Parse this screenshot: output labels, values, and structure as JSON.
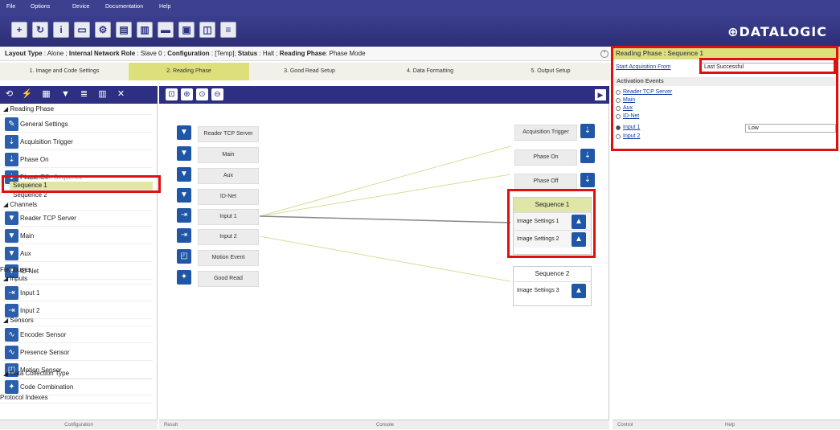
{
  "menu": [
    "File",
    "Options",
    "Device",
    "Documentation",
    "Help"
  ],
  "brand": "DATALOGIC",
  "info": {
    "layout_type_label": "Layout Type",
    "layout_type": "Alone",
    "network_role_label": "Internal Network Role",
    "network_role": "Slave 0",
    "configuration_label": "Configuration",
    "configuration": "[Temp]",
    "status_label": "Status",
    "status": "Halt",
    "reading_phase_label": "Reading Phase",
    "reading_phase": "Phase Mode"
  },
  "steps": [
    "1. Image and Code Settings",
    "2. Reading Phase",
    "3. Good Read Setup",
    "4. Data Formatting",
    "5. Output Setup"
  ],
  "tree": {
    "reading_phase": "Reading Phase",
    "general_settings": "General Settings",
    "acquisition_trigger": "Acquisition Trigger",
    "phase_on": "Phase On",
    "phase_off": "Phase Off",
    "acquisition_sequence": "Acquisition Sequence",
    "sequence1": "Sequence 1",
    "sequence2": "Sequence 2",
    "channels": "Channels",
    "reader_tcp_server": "Reader TCP Server",
    "main": "Main",
    "aux": "Aux",
    "id_net": "ID-Net",
    "fieldbuses": "Fieldbuses",
    "inputs": "Inputs",
    "input1": "Input 1",
    "input2": "Input 2",
    "sensors": "Sensors",
    "encoder_sensor": "Encoder Sensor",
    "presence_sensor": "Presence Sensor",
    "motion_sensor": "Motion Sensor",
    "data_collection_type": "Data Collection Type",
    "code_combination": "Code Combination",
    "protocol_indexes": "Protocol Indexes"
  },
  "left_footer": "Configuration",
  "canvas": {
    "left_nodes": [
      "Reader TCP Server",
      "Main",
      "Aux",
      "ID-Net",
      "Input 1",
      "Input 2",
      "Motion Event",
      "Good Read"
    ],
    "right_nodes": [
      "Acquisition Trigger",
      "Phase On",
      "Phase Off"
    ],
    "seq1": {
      "title": "Sequence  1",
      "rows": [
        "Image Settings  1",
        "Image Settings  2"
      ]
    },
    "seq2": {
      "title": "Sequence  2",
      "rows": [
        "Image Settings  3"
      ]
    }
  },
  "console": {
    "result": "Result",
    "console": "Console"
  },
  "right": {
    "title": "Reading Phase  :  Sequence 1",
    "acq_label": "Start Acquisition From",
    "acq_value": "Last Successful",
    "activation_header": "Activation Events",
    "events": [
      "Reader TCP Server",
      "Main",
      "Aux",
      "ID-Net",
      "Input 1",
      "Input 2"
    ],
    "input1_value": "Low",
    "footer_control": "Control",
    "footer_help": "Help"
  },
  "colors": {
    "accent": "#2d3082",
    "active_step": "#dcdf7a",
    "highlight": "#e01010"
  }
}
